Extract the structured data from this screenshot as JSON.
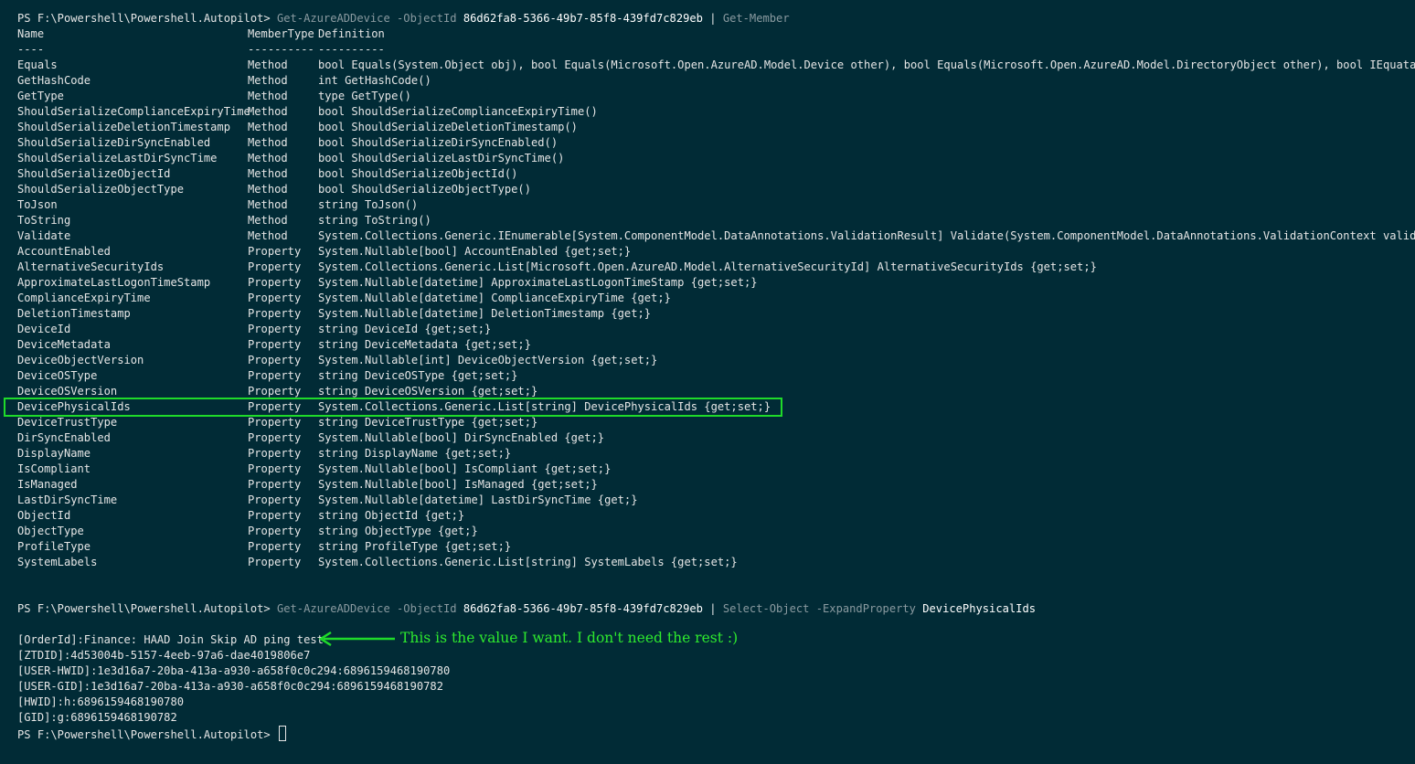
{
  "cmd1": {
    "prompt": "PS F:\\Powershell\\Powershell.Autopilot>",
    "cmdlet": "Get-AzureADDevice",
    "param": "-ObjectId",
    "value": "86d62fa8-5366-49b7-85f8-439fd7c829eb",
    "pipe": "|",
    "pipe_cmd": "Get-Member"
  },
  "table": {
    "headers": {
      "name": "Name",
      "type": "MemberType",
      "def": "Definition"
    },
    "separators": {
      "name": "----",
      "type": "----------",
      "def": "----------"
    },
    "rows": [
      {
        "name": "Equals",
        "type": "Method",
        "def": "bool Equals(System.Object obj), bool Equals(Microsoft.Open.AzureAD.Model.Device other), bool Equals(Microsoft.Open.AzureAD.Model.DirectoryObject other), bool IEquatabl..."
      },
      {
        "name": "GetHashCode",
        "type": "Method",
        "def": "int GetHashCode()"
      },
      {
        "name": "GetType",
        "type": "Method",
        "def": "type GetType()"
      },
      {
        "name": "ShouldSerializeComplianceExpiryTime",
        "type": "Method",
        "def": "bool ShouldSerializeComplianceExpiryTime()"
      },
      {
        "name": "ShouldSerializeDeletionTimestamp",
        "type": "Method",
        "def": "bool ShouldSerializeDeletionTimestamp()"
      },
      {
        "name": "ShouldSerializeDirSyncEnabled",
        "type": "Method",
        "def": "bool ShouldSerializeDirSyncEnabled()"
      },
      {
        "name": "ShouldSerializeLastDirSyncTime",
        "type": "Method",
        "def": "bool ShouldSerializeLastDirSyncTime()"
      },
      {
        "name": "ShouldSerializeObjectId",
        "type": "Method",
        "def": "bool ShouldSerializeObjectId()"
      },
      {
        "name": "ShouldSerializeObjectType",
        "type": "Method",
        "def": "bool ShouldSerializeObjectType()"
      },
      {
        "name": "ToJson",
        "type": "Method",
        "def": "string ToJson()"
      },
      {
        "name": "ToString",
        "type": "Method",
        "def": "string ToString()"
      },
      {
        "name": "Validate",
        "type": "Method",
        "def": "System.Collections.Generic.IEnumerable[System.ComponentModel.DataAnnotations.ValidationResult] Validate(System.ComponentModel.DataAnnotations.ValidationContext validat..."
      },
      {
        "name": "AccountEnabled",
        "type": "Property",
        "def": "System.Nullable[bool] AccountEnabled {get;set;}"
      },
      {
        "name": "AlternativeSecurityIds",
        "type": "Property",
        "def": "System.Collections.Generic.List[Microsoft.Open.AzureAD.Model.AlternativeSecurityId] AlternativeSecurityIds {get;set;}"
      },
      {
        "name": "ApproximateLastLogonTimeStamp",
        "type": "Property",
        "def": "System.Nullable[datetime] ApproximateLastLogonTimeStamp {get;set;}"
      },
      {
        "name": "ComplianceExpiryTime",
        "type": "Property",
        "def": "System.Nullable[datetime] ComplianceExpiryTime {get;}"
      },
      {
        "name": "DeletionTimestamp",
        "type": "Property",
        "def": "System.Nullable[datetime] DeletionTimestamp {get;}"
      },
      {
        "name": "DeviceId",
        "type": "Property",
        "def": "string DeviceId {get;set;}"
      },
      {
        "name": "DeviceMetadata",
        "type": "Property",
        "def": "string DeviceMetadata {get;set;}"
      },
      {
        "name": "DeviceObjectVersion",
        "type": "Property",
        "def": "System.Nullable[int] DeviceObjectVersion {get;set;}"
      },
      {
        "name": "DeviceOSType",
        "type": "Property",
        "def": "string DeviceOSType {get;set;}"
      },
      {
        "name": "DeviceOSVersion",
        "type": "Property",
        "def": "string DeviceOSVersion {get;set;}"
      },
      {
        "name": "DevicePhysicalIds",
        "type": "Property",
        "def": "System.Collections.Generic.List[string] DevicePhysicalIds {get;set;}"
      },
      {
        "name": "DeviceTrustType",
        "type": "Property",
        "def": "string DeviceTrustType {get;set;}"
      },
      {
        "name": "DirSyncEnabled",
        "type": "Property",
        "def": "System.Nullable[bool] DirSyncEnabled {get;}"
      },
      {
        "name": "DisplayName",
        "type": "Property",
        "def": "string DisplayName {get;set;}"
      },
      {
        "name": "IsCompliant",
        "type": "Property",
        "def": "System.Nullable[bool] IsCompliant {get;set;}"
      },
      {
        "name": "IsManaged",
        "type": "Property",
        "def": "System.Nullable[bool] IsManaged {get;set;}"
      },
      {
        "name": "LastDirSyncTime",
        "type": "Property",
        "def": "System.Nullable[datetime] LastDirSyncTime {get;}"
      },
      {
        "name": "ObjectId",
        "type": "Property",
        "def": "string ObjectId {get;}"
      },
      {
        "name": "ObjectType",
        "type": "Property",
        "def": "string ObjectType {get;}"
      },
      {
        "name": "ProfileType",
        "type": "Property",
        "def": "string ProfileType {get;set;}"
      },
      {
        "name": "SystemLabels",
        "type": "Property",
        "def": "System.Collections.Generic.List[string] SystemLabels {get;set;}"
      }
    ]
  },
  "cmd2": {
    "prompt": "PS F:\\Powershell\\Powershell.Autopilot>",
    "cmdlet": "Get-AzureADDevice",
    "param": "-ObjectId",
    "value": "86d62fa8-5366-49b7-85f8-439fd7c829eb",
    "pipe": "|",
    "pipe_cmd": "Select-Object",
    "pipe_param": "-ExpandProperty",
    "pipe_value": "DevicePhysicalIds"
  },
  "output": [
    "[OrderId]:Finance: HAAD Join Skip AD ping test",
    "[ZTDID]:4d53004b-5157-4eeb-97a6-dae4019806e7",
    "[USER-HWID]:1e3d16a7-20ba-413a-a930-a658f0c0c294:6896159468190780",
    "[USER-GID]:1e3d16a7-20ba-413a-a930-a658f0c0c294:6896159468190782",
    "[HWID]:h:6896159468190780",
    "[GID]:g:6896159468190782"
  ],
  "final_prompt": "PS F:\\Powershell\\Powershell.Autopilot>",
  "annotation": {
    "text": "This is the value I want. I don't need the rest :)",
    "color": "#2eea2e",
    "highlight_color": "#1fdb2a"
  },
  "colors": {
    "background": "#012b36",
    "text": "#e6e6e6",
    "dim": "#8a9aa0"
  }
}
